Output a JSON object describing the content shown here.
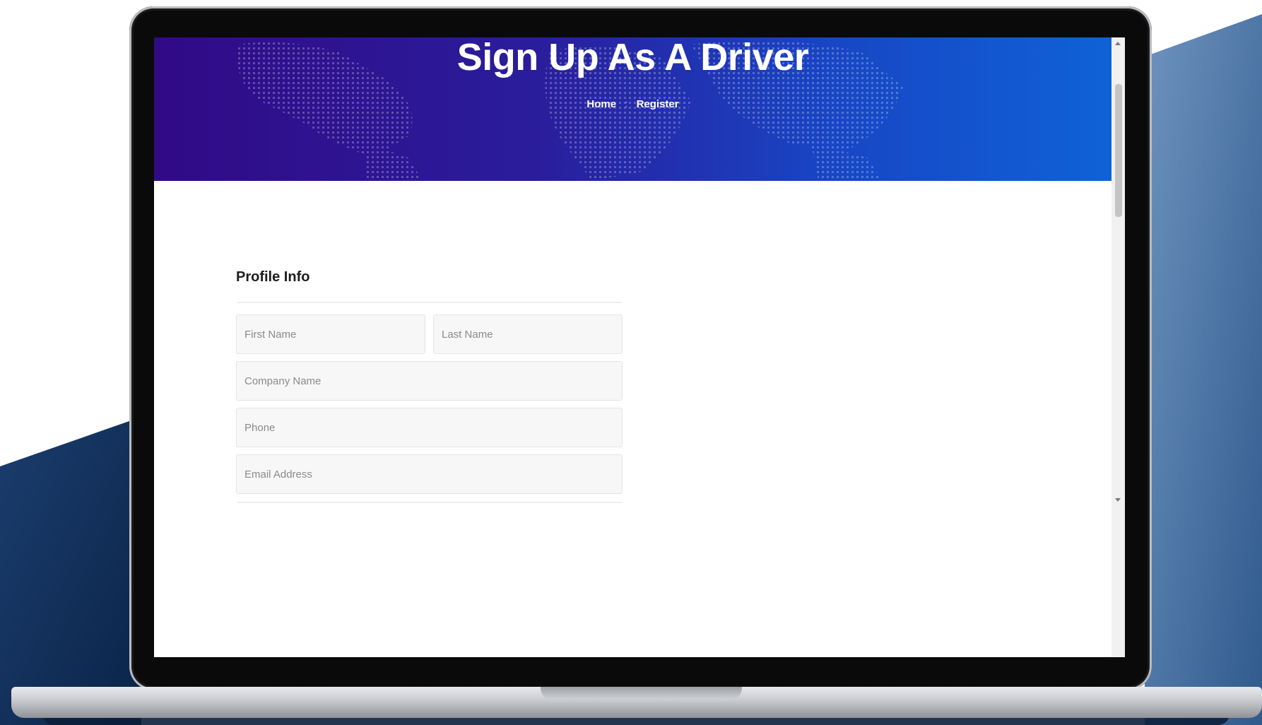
{
  "page": {
    "hero_title": "Sign Up As A Driver",
    "breadcrumb": {
      "home": "Home",
      "separator": ":",
      "current": "Register"
    }
  },
  "form": {
    "section_title": "Profile Info",
    "fields": {
      "first_name": {
        "placeholder": "First Name",
        "value": ""
      },
      "last_name": {
        "placeholder": "Last Name",
        "value": ""
      },
      "company_name": {
        "placeholder": "Company Name",
        "value": ""
      },
      "phone": {
        "placeholder": "Phone",
        "value": ""
      },
      "email": {
        "placeholder": "Email Address",
        "value": ""
      }
    }
  },
  "colors": {
    "hero_gradient_start": "#310a86",
    "hero_gradient_end": "#0f62d6",
    "backdrop_navy": "#0b2a57",
    "backdrop_steel": "#3f6da3"
  },
  "icons": {
    "scroll_up": "triangle-up",
    "scroll_down": "triangle-down"
  }
}
